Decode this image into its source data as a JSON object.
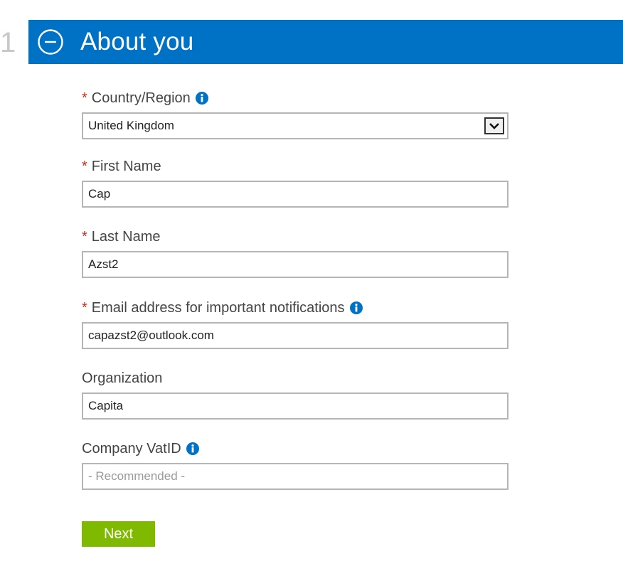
{
  "step": {
    "number": "1",
    "title": "About you"
  },
  "fields": {
    "country": {
      "label": "Country/Region",
      "required_marker": "*",
      "value": "United Kingdom"
    },
    "first_name": {
      "label": "First Name",
      "required_marker": "*",
      "value": "Cap"
    },
    "last_name": {
      "label": "Last Name",
      "required_marker": "*",
      "value": "Azst2"
    },
    "email": {
      "label": "Email address for important notifications",
      "required_marker": "*",
      "value": "capazst2@outlook.com"
    },
    "organization": {
      "label": "Organization",
      "value": "Capita"
    },
    "vat_id": {
      "label": "Company VatID",
      "value": "",
      "placeholder": "- Recommended -"
    }
  },
  "actions": {
    "next_label": "Next"
  },
  "colors": {
    "header_bg": "#0072c6",
    "next_button_bg": "#7fba00",
    "required_marker": "#c42b1c",
    "info_icon": "#0072c6"
  },
  "icons": {
    "collapse": "minus-circle-icon",
    "info": "info-icon",
    "dropdown": "chevron-down-icon"
  }
}
